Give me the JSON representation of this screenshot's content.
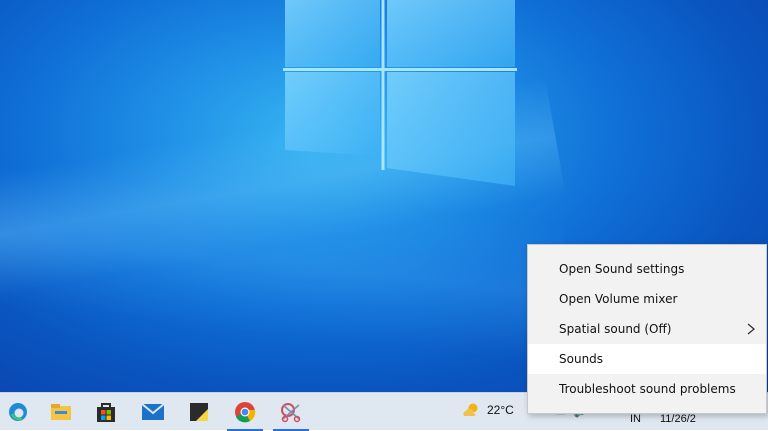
{
  "context_menu": {
    "items": [
      {
        "label": "Open Sound settings",
        "has_submenu": false
      },
      {
        "label": "Open Volume mixer",
        "has_submenu": false
      },
      {
        "label": "Spatial sound (Off)",
        "has_submenu": true
      },
      {
        "label": "Sounds",
        "has_submenu": false,
        "highlighted": true
      },
      {
        "label": "Troubleshoot sound problems",
        "has_submenu": false
      }
    ]
  },
  "taskbar": {
    "pinned_apps": [
      {
        "name": "edge-icon",
        "active": false
      },
      {
        "name": "file-explorer-icon",
        "active": false
      },
      {
        "name": "microsoft-store-icon",
        "active": false
      },
      {
        "name": "mail-icon",
        "active": false
      },
      {
        "name": "sticky-notes-icon",
        "active": false
      },
      {
        "name": "chrome-icon",
        "active": true
      },
      {
        "name": "snip-sketch-icon",
        "active": true
      }
    ],
    "weather": {
      "temperature": "22°C",
      "icon": "partly-cloudy-icon"
    },
    "language": "IN",
    "clock": {
      "date": "11/26/2"
    }
  },
  "colors": {
    "accent": "#2a6fd6",
    "menu_bg": "#f2f2f2",
    "taskbar_bg": "#dfe7f1"
  }
}
